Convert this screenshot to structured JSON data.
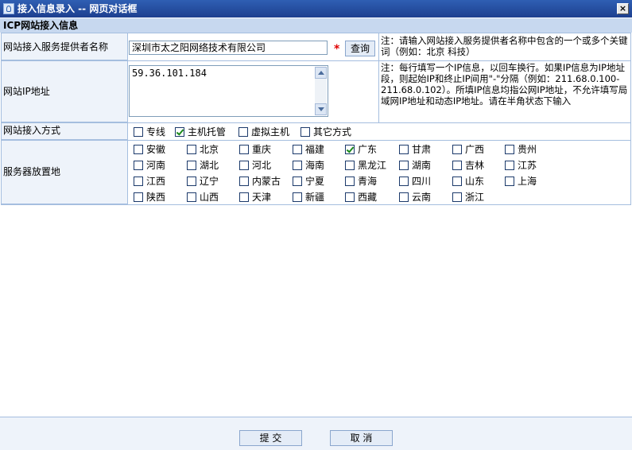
{
  "window": {
    "title": "接入信息录入 -- 网页对话框",
    "close_label": "×"
  },
  "section_title": "ICP网站接入信息",
  "provider": {
    "label": "网站接入服务提供者名称",
    "value": "深圳市太之阳网络技术有限公司",
    "required_mark": "*",
    "query_button": "查询",
    "note": "注：请输入网站接入服务提供者名称中包含的一个或多个关键词（例如：北京 科技）"
  },
  "ip": {
    "label": "网站IP地址",
    "value": "59.36.101.184",
    "note": "注：每行填写一个IP信息，以回车换行。如果IP信息为IP地址段，则起始IP和终止IP间用\"-\"分隔（例如：211.68.0.100-211.68.0.102）。所填IP信息均指公网IP地址，不允许填写局域网IP地址和动态IP地址。请在半角状态下输入"
  },
  "access_method": {
    "label": "网站接入方式",
    "options": [
      {
        "label": "专线",
        "checked": false
      },
      {
        "label": "主机托管",
        "checked": true
      },
      {
        "label": "虚拟主机",
        "checked": false
      },
      {
        "label": "其它方式",
        "checked": false
      }
    ]
  },
  "server_location": {
    "label": "服务器放置地",
    "options": [
      {
        "label": "安徽",
        "checked": false
      },
      {
        "label": "北京",
        "checked": false
      },
      {
        "label": "重庆",
        "checked": false
      },
      {
        "label": "福建",
        "checked": false
      },
      {
        "label": "广东",
        "checked": true
      },
      {
        "label": "甘肃",
        "checked": false
      },
      {
        "label": "广西",
        "checked": false
      },
      {
        "label": "贵州",
        "checked": false
      },
      {
        "label": "河南",
        "checked": false
      },
      {
        "label": "湖北",
        "checked": false
      },
      {
        "label": "河北",
        "checked": false
      },
      {
        "label": "海南",
        "checked": false
      },
      {
        "label": "黑龙江",
        "checked": false
      },
      {
        "label": "湖南",
        "checked": false
      },
      {
        "label": "吉林",
        "checked": false
      },
      {
        "label": "江苏",
        "checked": false
      },
      {
        "label": "江西",
        "checked": false
      },
      {
        "label": "辽宁",
        "checked": false
      },
      {
        "label": "内蒙古",
        "checked": false
      },
      {
        "label": "宁夏",
        "checked": false
      },
      {
        "label": "青海",
        "checked": false
      },
      {
        "label": "四川",
        "checked": false
      },
      {
        "label": "山东",
        "checked": false
      },
      {
        "label": "上海",
        "checked": false
      },
      {
        "label": "陕西",
        "checked": false
      },
      {
        "label": "山西",
        "checked": false
      },
      {
        "label": "天津",
        "checked": false
      },
      {
        "label": "新疆",
        "checked": false
      },
      {
        "label": "西藏",
        "checked": false
      },
      {
        "label": "云南",
        "checked": false
      },
      {
        "label": "浙江",
        "checked": false
      }
    ]
  },
  "footer": {
    "submit_label": "提 交",
    "cancel_label": "取 消"
  }
}
